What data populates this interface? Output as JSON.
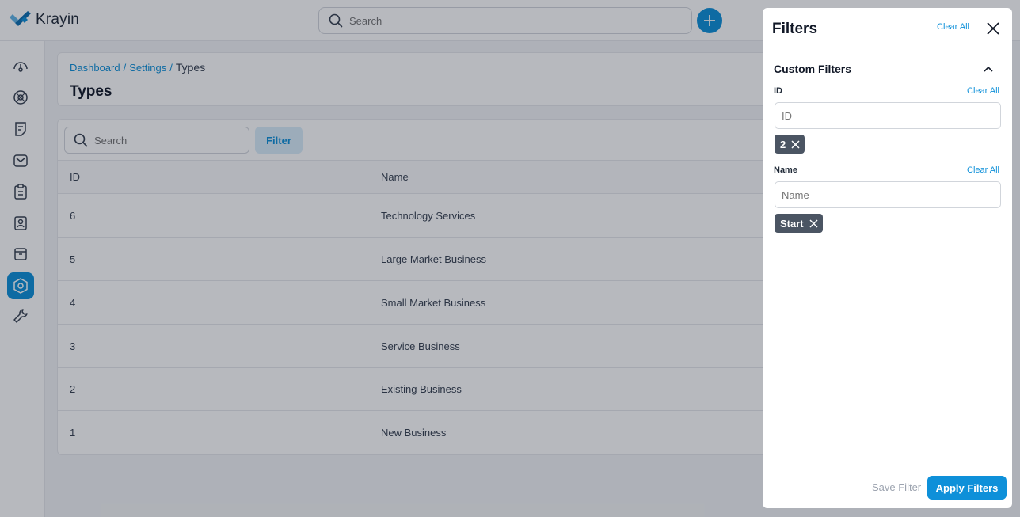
{
  "app": {
    "name": "Krayin"
  },
  "topbar": {
    "search_placeholder": "Search"
  },
  "sidebar": {
    "items": [
      {
        "icon": "dashboard-icon"
      },
      {
        "icon": "leads-icon"
      },
      {
        "icon": "quotes-icon"
      },
      {
        "icon": "mail-icon"
      },
      {
        "icon": "activities-icon"
      },
      {
        "icon": "contacts-icon"
      },
      {
        "icon": "products-icon"
      },
      {
        "icon": "settings-icon",
        "active": true
      },
      {
        "icon": "configuration-icon"
      }
    ]
  },
  "breadcrumb": {
    "items": [
      "Dashboard",
      "Settings"
    ],
    "current": "Types",
    "separator": "/"
  },
  "page": {
    "title": "Types"
  },
  "table": {
    "search_placeholder": "Search",
    "filter_label": "Filter",
    "columns": [
      "ID",
      "Name"
    ],
    "rows": [
      {
        "id": "6",
        "name": "Technology Services"
      },
      {
        "id": "5",
        "name": "Large Market Business"
      },
      {
        "id": "4",
        "name": "Small Market Business"
      },
      {
        "id": "3",
        "name": "Service Business"
      },
      {
        "id": "2",
        "name": "Existing Business"
      },
      {
        "id": "1",
        "name": "New Business"
      }
    ]
  },
  "filter_panel": {
    "title": "Filters",
    "clear_all": "Clear All",
    "section_title": "Custom Filters",
    "fields": [
      {
        "label": "ID",
        "clear": "Clear All",
        "placeholder": "ID",
        "chip": "2"
      },
      {
        "label": "Name",
        "clear": "Clear All",
        "placeholder": "Name",
        "chip": "Start"
      }
    ],
    "save_filter": "Save Filter",
    "apply_filters": "Apply Filters"
  },
  "colors": {
    "accent": "#0e90d9",
    "chip": "#4b5563",
    "overlay": "rgba(17,24,39,0.30)"
  }
}
